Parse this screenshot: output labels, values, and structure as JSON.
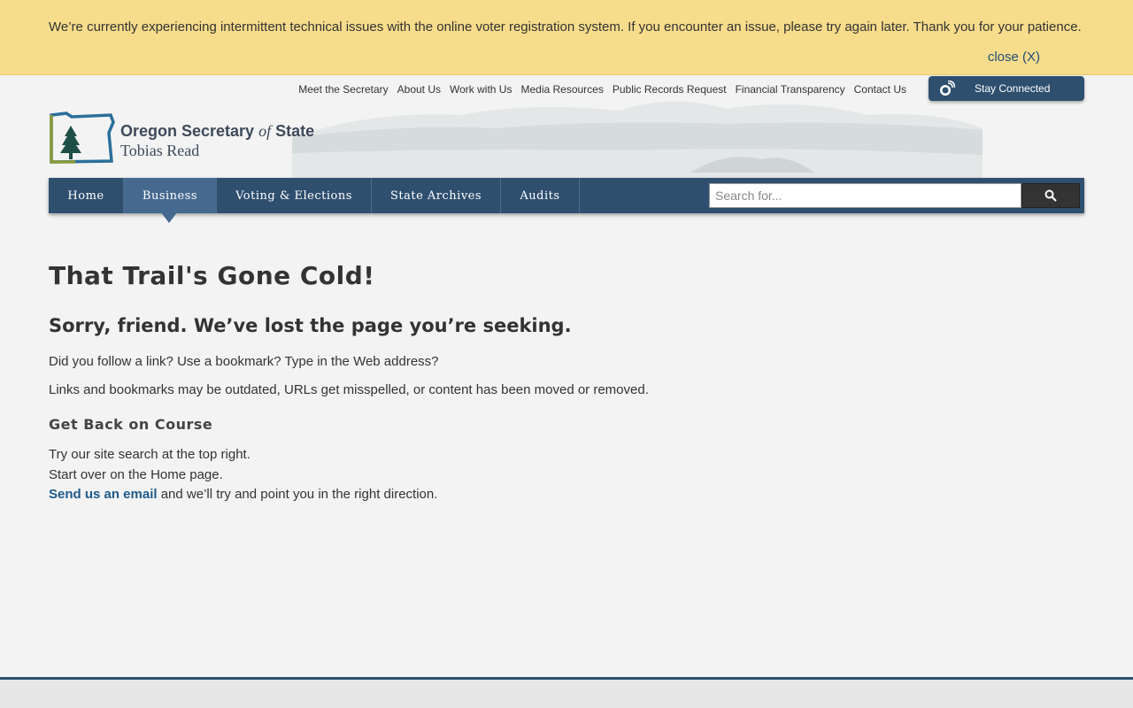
{
  "alert": {
    "message": "We’re currently experiencing intermittent technical issues with the online voter registration system. If you encounter an issue, please try again later. Thank you for your patience.",
    "close_label": "close (X)"
  },
  "utility_nav": [
    {
      "label": "Meet the Secretary"
    },
    {
      "label": "About Us"
    },
    {
      "label": "Work with Us"
    },
    {
      "label": "Media Resources"
    },
    {
      "label": "Public Records Request"
    },
    {
      "label": "Financial Transparency"
    },
    {
      "label": "Contact Us"
    }
  ],
  "stay_connected": {
    "label": "Stay Connected",
    "icon": "satellite-dish-icon"
  },
  "logo": {
    "title_pre": "Oregon Secretary",
    "title_of": "of",
    "title_post": "State",
    "subtitle": "Tobias Read"
  },
  "main_nav": {
    "items": [
      {
        "label": "Home",
        "active": false
      },
      {
        "label": "Business",
        "active": true
      },
      {
        "label": "Voting & Elections",
        "active": false
      },
      {
        "label": "State Archives",
        "active": false
      },
      {
        "label": "Audits",
        "active": false
      }
    ]
  },
  "search": {
    "placeholder": "Search for...",
    "value": "",
    "icon": "search-icon"
  },
  "content": {
    "heading": "That Trail's Gone Cold!",
    "subheading": "Sorry, friend. We’ve lost the page you’re seeking.",
    "para1": "Did you follow a link? Use a bookmark? Type in the Web address?",
    "para2": "Links and bookmarks may be outdated, URLs get misspelled, or content has been moved or removed.",
    "section_heading": "Get Back on Course",
    "line1": "Try our site search at the top right.",
    "line2": "Start over on the Home page.",
    "email_link": "Send us an email",
    "line3_rest": " and we’ll try and point you in the right direction."
  },
  "colors": {
    "alert_bg": "#f7dc8b",
    "nav_bg": "#2f4f6f",
    "nav_active": "#46698f",
    "link": "#1f5a8a"
  }
}
